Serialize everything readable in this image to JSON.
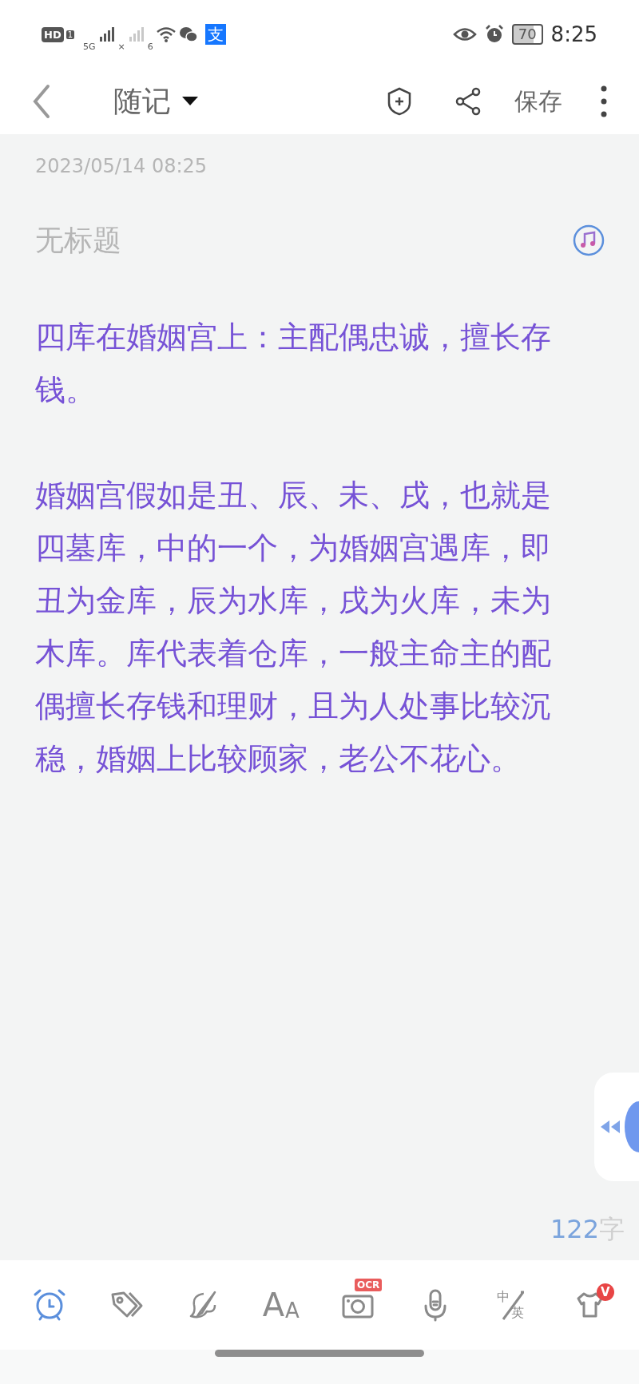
{
  "status_bar": {
    "left": [
      {
        "kind": "hd",
        "text": "HD",
        "sub": "1"
      },
      {
        "kind": "signal",
        "text": "5G"
      },
      {
        "kind": "nosignal",
        "text": "×"
      },
      {
        "kind": "wifi",
        "text": "6"
      },
      {
        "kind": "wechat"
      },
      {
        "kind": "alipay",
        "text": "支"
      }
    ],
    "battery": "70",
    "time": "8:25"
  },
  "top_bar": {
    "title": "随记",
    "save": "保存"
  },
  "note": {
    "date": "2023/05/14 08:25",
    "title_placeholder": "无标题",
    "paragraphs": [
      "四库在婚姻宫上：主配偶忠诚，擅长存钱。",
      "婚姻宫假如是丑、辰、未、戌，也就是四墓库，中的一个，为婚姻宫遇库，即丑为金库，辰为水库，戌为火库，未为木库。库代表着仓库，一般主命主的配偶擅长存钱和理财，且为人处事比较沉稳，婚姻上比较顾家，老公不花心。"
    ],
    "count": "122",
    "count_unit": "字"
  },
  "toolbar": [
    {
      "kind": "alarm",
      "selected": true
    },
    {
      "kind": "tag",
      "selected": false
    },
    {
      "kind": "brush",
      "selected": false
    },
    {
      "kind": "font",
      "label": "AA",
      "selected": false
    },
    {
      "kind": "camera",
      "badge": "OCR",
      "selected": false
    },
    {
      "kind": "mic",
      "selected": false
    },
    {
      "kind": "translate",
      "top": "中",
      "bottom": "英",
      "selected": false
    },
    {
      "kind": "shirt",
      "badge": "V",
      "selected": false
    }
  ]
}
